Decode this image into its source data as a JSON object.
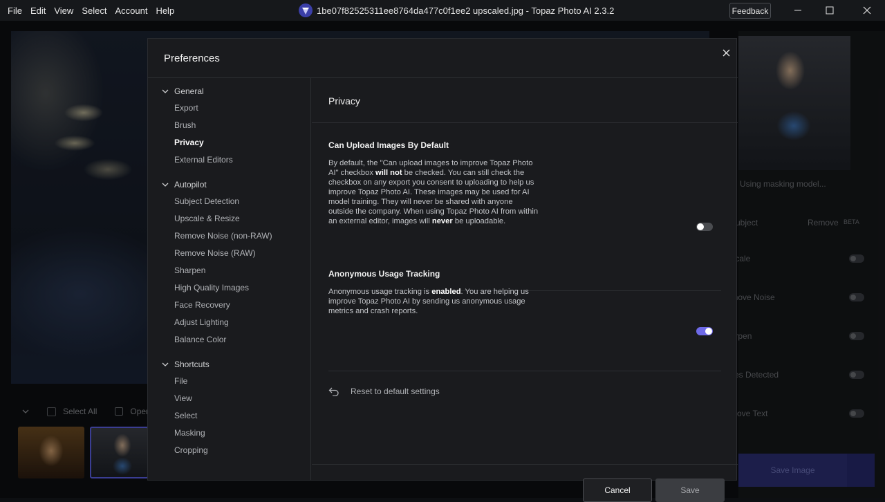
{
  "titlebar": {
    "menu": [
      "File",
      "Edit",
      "View",
      "Select",
      "Account",
      "Help"
    ],
    "window_title": "1be07f82525311ee8764da477c0f1ee2 upscaled.jpg - Topaz Photo AI 2.3.2",
    "feedback": "Feedback"
  },
  "background": {
    "select_all": "Select All",
    "open": "Open",
    "right_panel": {
      "masking": "Using masking model...",
      "subject": "Subject",
      "remove": "Remove",
      "beta": "BETA",
      "upscale": "Upscale",
      "remove_noise": "Remove Noise",
      "sharpen": "Sharpen",
      "faces": "Faces Detected",
      "text": "Improve Text",
      "save_image": "Save Image"
    }
  },
  "modal": {
    "title": "Preferences",
    "sidebar": {
      "groups": [
        {
          "label": "General",
          "items": [
            "Export",
            "Brush",
            "Privacy",
            "External Editors"
          ]
        },
        {
          "label": "Autopilot",
          "items": [
            "Subject Detection",
            "Upscale & Resize",
            "Remove Noise (non-RAW)",
            "Remove Noise (RAW)",
            "Sharpen",
            "High Quality Images",
            "Face Recovery",
            "Adjust Lighting",
            "Balance Color"
          ]
        },
        {
          "label": "Shortcuts",
          "items": [
            "File",
            "View",
            "Select",
            "Masking",
            "Cropping"
          ]
        }
      ],
      "active": "Privacy"
    },
    "content": {
      "title": "Privacy",
      "upload": {
        "title": "Can Upload Images By Default",
        "text_1": "By default, the \"Can upload images to improve Topaz Photo AI\" checkbox ",
        "bold_1": "will not",
        "text_2": " be checked. You can still check the checkbox on any export you consent to uploading to help us improve Topaz Photo AI. These images may be used for AI model training. They will never be shared with anyone outside the company. When using Topaz Photo AI from within an external editor, images will ",
        "bold_2": "never",
        "text_3": " be uploadable.",
        "enabled": false
      },
      "tracking": {
        "title": "Anonymous Usage Tracking",
        "text_1": "Anonymous usage tracking is ",
        "bold_1": "enabled",
        "text_2": ". You are helping us improve Topaz Photo AI by sending us anonymous usage metrics and crash reports.",
        "enabled": true
      },
      "reset": "Reset to default settings"
    },
    "buttons": {
      "cancel": "Cancel",
      "save": "Save"
    }
  }
}
